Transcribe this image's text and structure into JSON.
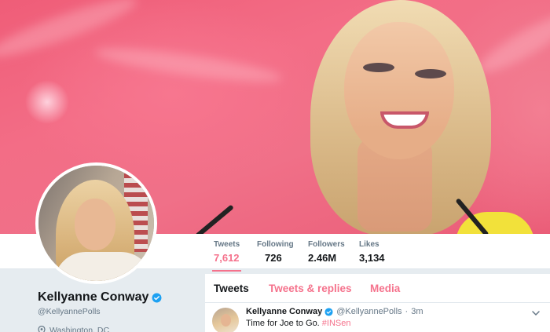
{
  "profile": {
    "name": "Kellyanne Conway",
    "handle": "@KellyannePolls",
    "location": "Washington, DC",
    "verified": true
  },
  "stats": [
    {
      "label": "Tweets",
      "value": "7,612",
      "active": true
    },
    {
      "label": "Following",
      "value": "726",
      "active": false
    },
    {
      "label": "Followers",
      "value": "2.46M",
      "active": false
    },
    {
      "label": "Likes",
      "value": "3,134",
      "active": false
    }
  ],
  "tabs": [
    {
      "label": "Tweets",
      "active": true
    },
    {
      "label": "Tweets & replies",
      "active": false
    },
    {
      "label": "Media",
      "active": false
    }
  ],
  "tweet": {
    "author_name": "Kellyanne Conway",
    "author_handle": "@KellyannePolls",
    "separator": "·",
    "time": "3m",
    "text_prefix": "Time for Joe to Go. ",
    "hashtag": "#INSen"
  },
  "colors": {
    "accent": "#f5728c",
    "verified": "#1da1f2",
    "banner": "#ef5d78"
  },
  "icons": [
    "verified-badge-icon",
    "location-pin-icon",
    "chevron-down-icon"
  ]
}
